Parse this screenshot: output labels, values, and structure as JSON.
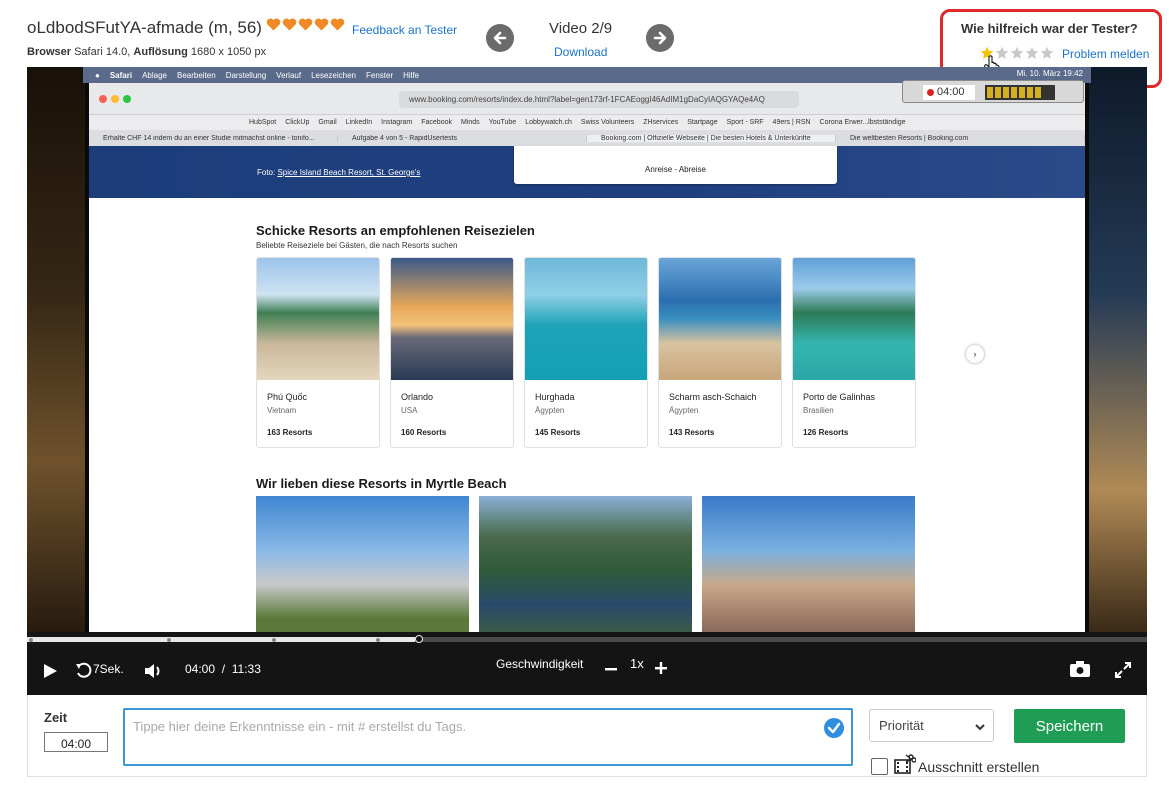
{
  "header": {
    "tester_name": "oLdbodSFutYA-afmade (m, 56)",
    "heart_count": 5,
    "feedback_link": "Feedback an Tester",
    "browser_label": "Browser",
    "browser_value": "Safari 14.0,",
    "resolution_label": "Auflösung",
    "resolution_value": "1680 x 1050 px",
    "video_label": "Video 2/9",
    "download_label": "Download"
  },
  "rating": {
    "title": "Wie hilfreich war der Tester?",
    "stars_total": 5,
    "stars_filled": 1,
    "problem_link": "Problem melden"
  },
  "screen": {
    "mac_menu": [
      "Safari",
      "Ablage",
      "Bearbeiten",
      "Darstellung",
      "Verlauf",
      "Lesezeichen",
      "Fenster",
      "Hilfe"
    ],
    "mac_clock": "Mi. 10. März 19:42",
    "url": "www.booking.com/resorts/index.de.html?label=gen173rf-1FCAEoggI46AdIM1gDaCyIAQGYAQe4AQ",
    "bookmarks": [
      "HubSpot",
      "ClickUp",
      "Gmail",
      "LinkedIn",
      "Instagram",
      "Facebook",
      "Minds",
      "YouTube",
      "Lobbywatch.ch",
      "Swiss Volunteers",
      "ZHservices",
      "Startpage",
      "Sport - SRF",
      "49ers | RSN",
      "Corona Erwer...lbstständige"
    ],
    "tabs": [
      "Erhalte CHF 14 indem du an einer Studie mitmachst online - tonifo...",
      "Aufgabe 4 von 5 - RapidUsertests",
      "Booking.com | Offizielle Webseite | Die besten Hotels & Unterkünfte",
      "Die weltbesten Resorts | Booking.com"
    ],
    "recorder_time": "04:00",
    "hero_caption_prefix": "Foto: ",
    "hero_caption_link": "Spice Island Beach Resort, St. George's",
    "search_label": "Anreise - Abreise",
    "section1_title": "Schicke Resorts an empfohlenen Reisezielen",
    "section1_sub": "Beliebte Reiseziele bei Gästen, die nach Resorts suchen",
    "cards": [
      {
        "name": "Phú Quốc",
        "country": "Vietnam",
        "count": "163 Resorts"
      },
      {
        "name": "Orlando",
        "country": "USA",
        "count": "160 Resorts"
      },
      {
        "name": "Hurghada",
        "country": "Ägypten",
        "count": "145 Resorts"
      },
      {
        "name": "Scharm asch-Schaich",
        "country": "Ägypten",
        "count": "143 Resorts"
      },
      {
        "name": "Porto de Galinhas",
        "country": "Brasilien",
        "count": "126 Resorts"
      }
    ],
    "section2_title": "Wir lieben diese Resorts in Myrtle Beach"
  },
  "player": {
    "skip_label": "7Sek.",
    "current_time": "04:00",
    "duration": "11:33",
    "speed_label": "Geschwindigkeit",
    "speed_value": "1x",
    "progress_fraction": 0.35,
    "buffer_fraction": 0.346
  },
  "form": {
    "time_label": "Zeit",
    "time_value": "04:00",
    "notes_placeholder": "Tippe hier deine Erkenntnisse ein - mit # erstellst du Tags.",
    "priority_value": "Priorität",
    "save_label": "Speichern",
    "cut_label": "Ausschnitt erstellen"
  },
  "colors": {
    "link": "#1a73c8",
    "heart": "#f08a24",
    "highlight_border": "#e02a2a",
    "save_button": "#1f9d55",
    "input_focus": "#3b9ad6"
  }
}
